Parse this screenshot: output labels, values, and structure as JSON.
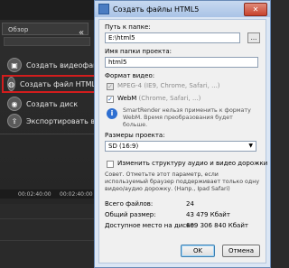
{
  "app": {
    "tab_label": "Обзор",
    "collapse_glyph": "«",
    "menu": [
      {
        "label": "Создать видеофайл",
        "icon": "film-icon"
      },
      {
        "label": "Создать файл HTML5",
        "icon": "html5-globe-icon"
      },
      {
        "label": "Создать диск",
        "icon": "disc-icon"
      },
      {
        "label": "Экспортировать в кач",
        "icon": "export-icon"
      }
    ],
    "timeline": {
      "t1": "00:02:40:00",
      "t2": "00:02:40:00"
    },
    "highlight_color": "#d21d1d"
  },
  "dialog": {
    "title": "Создать файлы HTML5",
    "close_glyph": "✕",
    "folder_path_label": "Путь к папке:",
    "folder_path_value": "E:\\html5",
    "browse_label": "...",
    "project_folder_label": "Имя папки проекта:",
    "project_folder_value": "html5",
    "video_format_label": "Формат видео:",
    "formats": [
      {
        "name": "MPEG-4",
        "hint": "(IE9, Chrome, Safari, ...)",
        "checked": true,
        "disabled": true
      },
      {
        "name": "WebM",
        "hint": "(Chrome, Safari, ...)",
        "checked": true,
        "disabled": false
      }
    ],
    "smartrender_note": "SmartRender нельзя применить к формату WebM. Время преобразования будет больше.",
    "project_size_label": "Размеры проекта:",
    "project_size_value": "SD (16:9)",
    "resize_label": "Изменить структуру аудио и видео дорожки",
    "tip": "Совет. Отметьте этот параметр, если используемый браузер поддерживает только одну видео/аудио дорожку. (Напр., Ipad Safari)",
    "stats": [
      {
        "label": "Всего файлов:",
        "value": "24"
      },
      {
        "label": "Общий размер:",
        "value": "43 479 Кбайт"
      },
      {
        "label": "Доступное место на диске:",
        "value": "609 306 840 Кбайт"
      }
    ],
    "ok_label": "OK",
    "cancel_label": "Отмена"
  }
}
